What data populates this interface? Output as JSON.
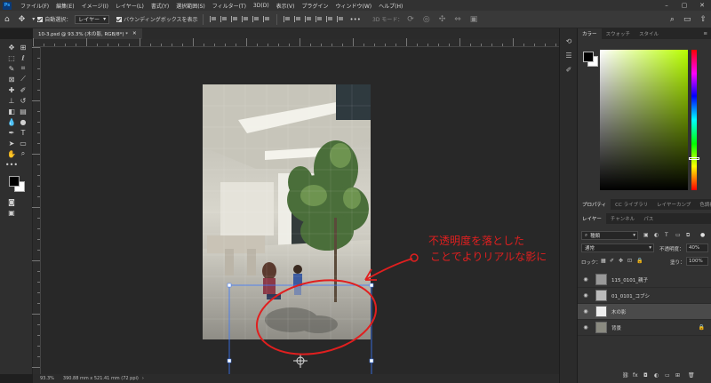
{
  "menubar": {
    "logo": "Ps",
    "items": [
      "ファイル(F)",
      "編集(E)",
      "イメージ(I)",
      "レイヤー(L)",
      "書式(Y)",
      "選択範囲(S)",
      "フィルター(T)",
      "3D(D)",
      "表示(V)",
      "プラグイン",
      "ウィンドウ(W)",
      "ヘルプ(H)"
    ]
  },
  "options": {
    "auto_select_label": "自動選択：",
    "auto_select_value": "レイヤー",
    "bbox_label": "バウンディングボックスを表示",
    "mode_3d": "3D モード："
  },
  "document": {
    "tab_title": "10-3.psd @ 93.3% (木の影, RGB/8*) *",
    "zoom": "93.3%",
    "size": "390.88 mm x 521.41 mm (72 ppi)"
  },
  "annotation": {
    "line1": "不透明度を落とした",
    "line2": "ことでよりリアルな影に"
  },
  "color_panel": {
    "tabs": [
      "カラー",
      "スウォッチ",
      "スタイル"
    ],
    "foreground": "#000000",
    "background": "#ffffff",
    "hue_color": "#b8ff00"
  },
  "prop_tabs": [
    "プロパティ",
    "CC ライブラリ",
    "レイヤーカンプ",
    "色調補正"
  ],
  "layers_panel": {
    "tabs": [
      "レイヤー",
      "チャンネル",
      "パス"
    ],
    "filter_label": "種類",
    "blend_mode": "通常",
    "opacity_label": "不透明度：",
    "opacity_value": "40%",
    "lock_label": "ロック：",
    "fill_label": "塗り：",
    "fill_value": "100%",
    "layers": [
      {
        "name": "115_0101_親子"
      },
      {
        "name": "01_0101_コブシ"
      },
      {
        "name": "木の影",
        "selected": true
      },
      {
        "name": "背景",
        "locked": true
      }
    ]
  }
}
